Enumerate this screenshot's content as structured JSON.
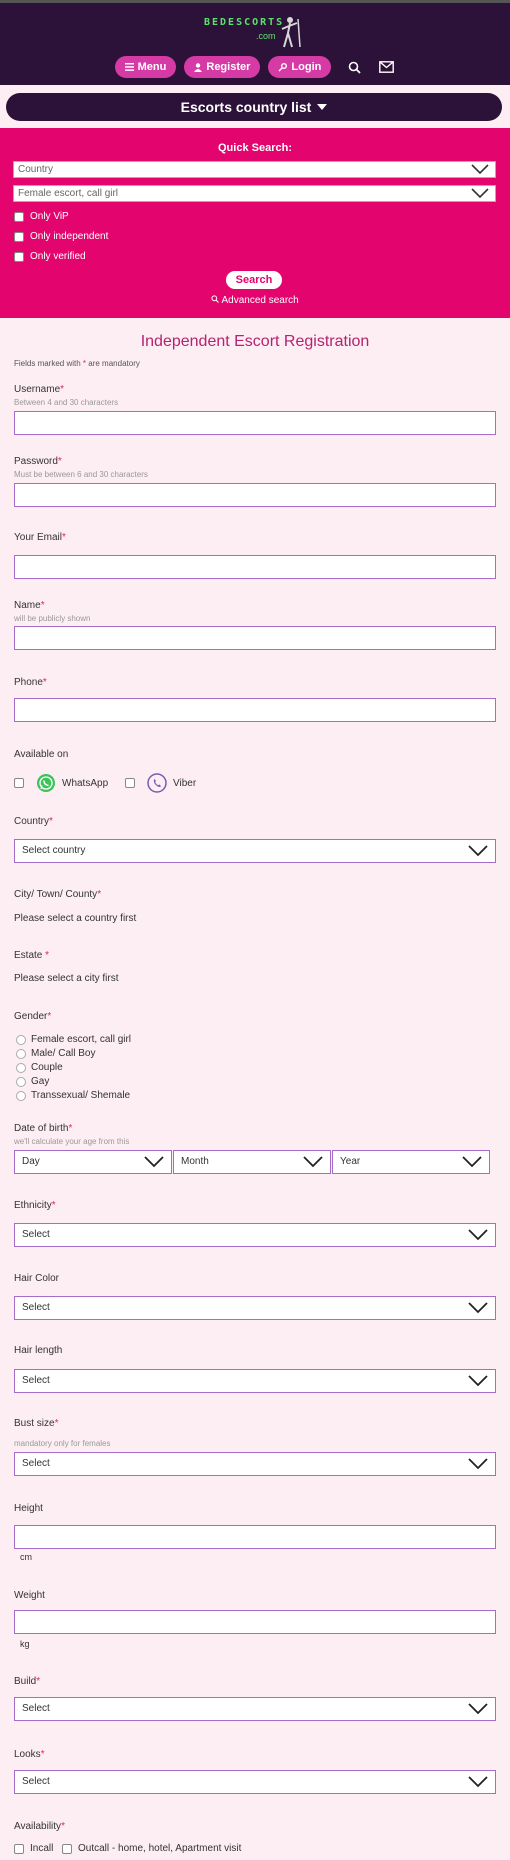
{
  "header": {
    "logo_text": "BEDESCORTS",
    "logo_sub": ".com",
    "nav": {
      "menu": "Menu",
      "register": "Register",
      "login": "Login",
      "search_icon": "search-icon",
      "mail_icon": "mail-icon"
    }
  },
  "country_bar": {
    "label": "Escorts country list"
  },
  "quick_search": {
    "title": "Quick Search:",
    "country_select": "Country",
    "type_select": "Female escort, call girl",
    "only_vip": "Only ViP",
    "only_independent": "Only independent",
    "only_verified": "Only verified",
    "search_button": "Search",
    "advanced": "Advanced search"
  },
  "form": {
    "title": "Independent Escort Registration",
    "note_pre": "Fields marked with ",
    "note_star": "*",
    "note_post": " are mandatory",
    "star": "*",
    "username": {
      "label": "Username",
      "hint": "Between 4 and 30 characters"
    },
    "password": {
      "label": "Password",
      "hint": "Must be between 6 and 30 characters"
    },
    "email": {
      "label": "Your Email"
    },
    "name": {
      "label": "Name",
      "hint": "will be publicly shown"
    },
    "phone": {
      "label": "Phone"
    },
    "available_on": {
      "label": "Available on",
      "whatsapp": "WhatsApp",
      "viber": "Viber"
    },
    "country": {
      "label": "Country",
      "value": "Select country"
    },
    "city": {
      "label": "City/ Town/ County",
      "text": "Please select a country first"
    },
    "estate": {
      "label": "Estate ",
      "text": "Please select a city first"
    },
    "gender": {
      "label": "Gender",
      "options": [
        "Female escort, call girl",
        "Male/ Call Boy",
        "Couple",
        "Gay",
        "Transsexual/ Shemale"
      ]
    },
    "dob": {
      "label": "Date of birth",
      "hint": "we'll calculate your age from this",
      "day": "Day",
      "month": "Month",
      "year": "Year"
    },
    "ethnicity": {
      "label": "Ethnicity",
      "value": "Select"
    },
    "hair_color": {
      "label": "Hair Color",
      "value": "Select"
    },
    "hair_length": {
      "label": "Hair length",
      "value": "Select"
    },
    "bust": {
      "label": "Bust size",
      "hint": "mandatory only for females",
      "value": "Select"
    },
    "height": {
      "label": "Height",
      "unit": "cm"
    },
    "weight": {
      "label": "Weight",
      "unit": "kg"
    },
    "build": {
      "label": "Build",
      "value": "Select"
    },
    "looks": {
      "label": "Looks",
      "value": "Select"
    },
    "availability": {
      "label": "Availability",
      "incall": "Incall",
      "outcall": "Outcall - home, hotel, Apartment visit"
    }
  },
  "colors": {
    "header_bg": "#2c1238",
    "accent_pink": "#e3046e",
    "pill_pink": "#d63aa5",
    "form_bg": "#fdeef4",
    "input_border": "#a66cc9",
    "title_color": "#b3236e"
  }
}
